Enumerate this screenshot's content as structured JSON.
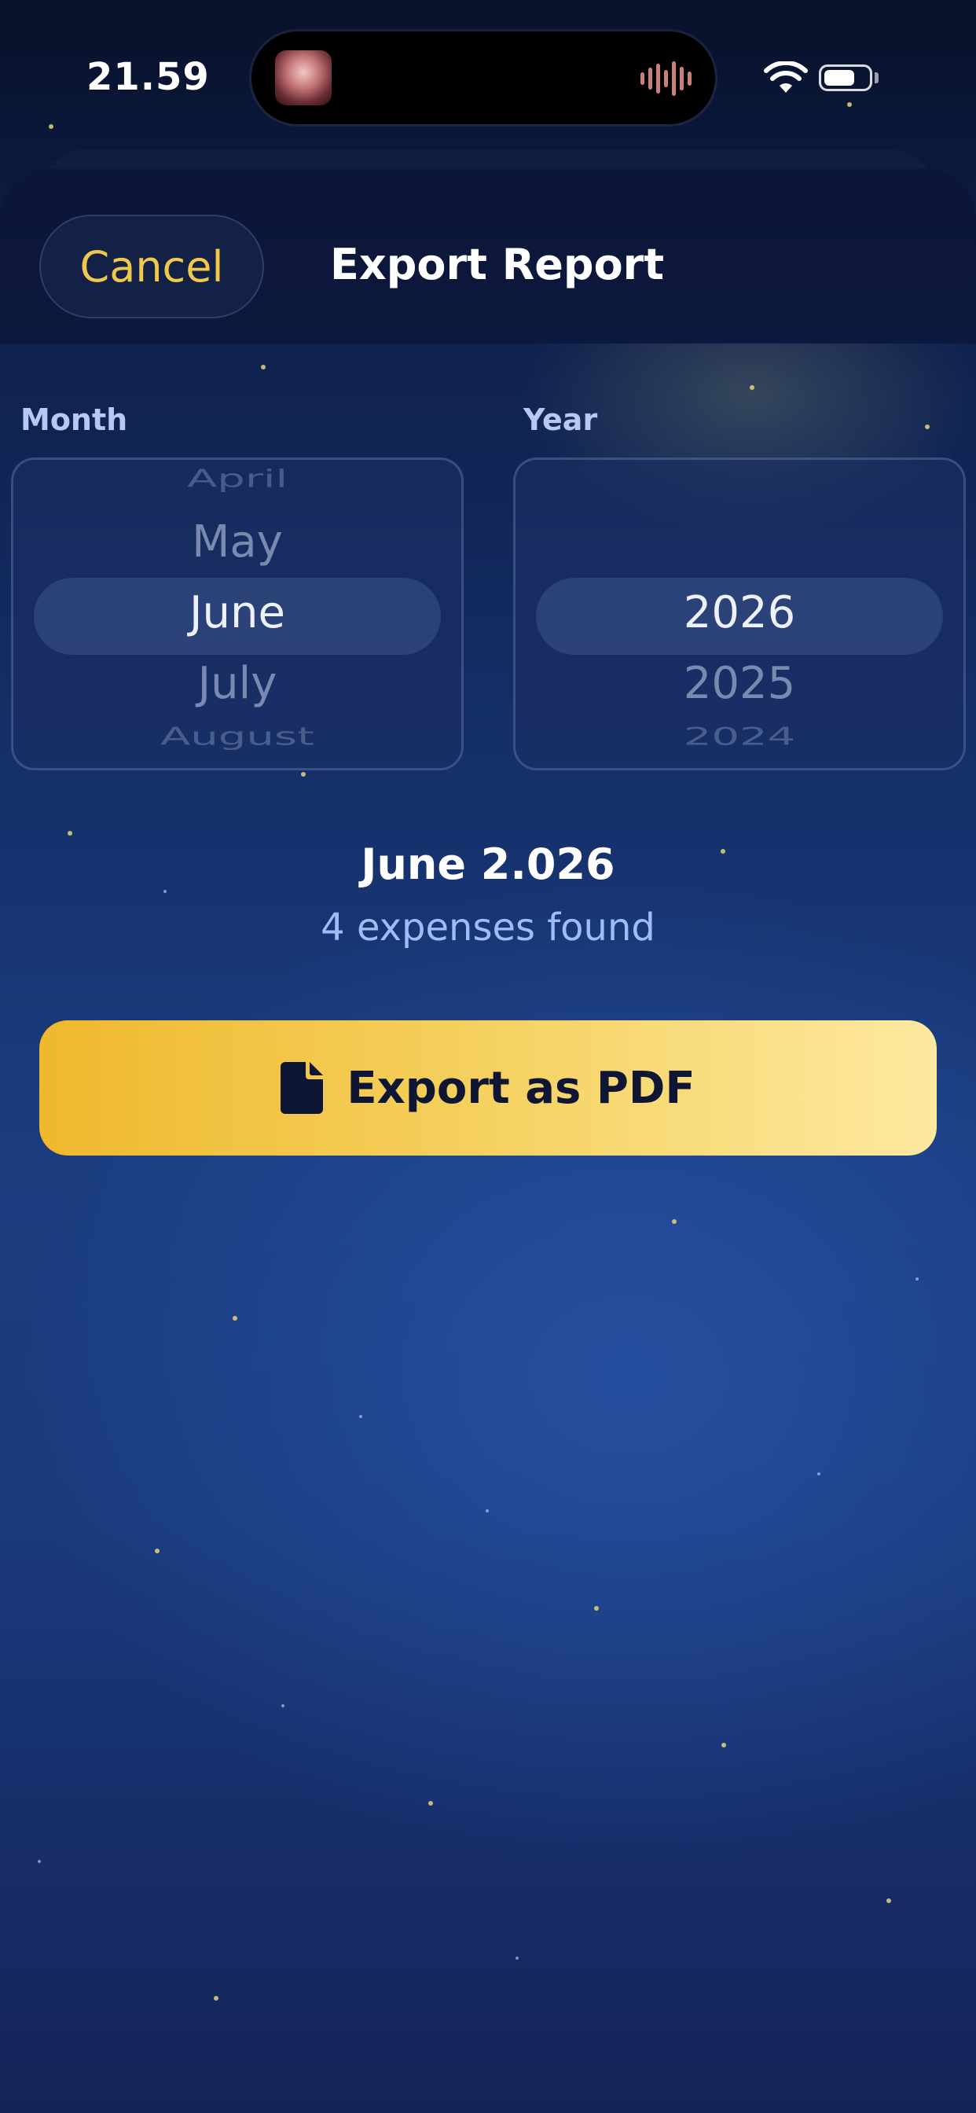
{
  "status_bar": {
    "time": "21.59",
    "battery_level": 0.7,
    "icons": [
      "wifi-icon",
      "battery-icon"
    ]
  },
  "dynamic_island": {
    "icons": [
      "media-thumbnail-icon",
      "audio-waveform-icon"
    ],
    "waveform_color": "#c9807b"
  },
  "header": {
    "cancel_label": "Cancel",
    "title": "Export Report"
  },
  "month_picker": {
    "label": "Month",
    "items": [
      "April",
      "May",
      "June",
      "July",
      "August"
    ],
    "selected": "June"
  },
  "year_picker": {
    "label": "Year",
    "items": [
      "2026",
      "2025",
      "2024"
    ],
    "selected": "2026"
  },
  "summary": {
    "period": "June 2.026",
    "count_text": "4 expenses found"
  },
  "export_button": {
    "label": "Export as PDF",
    "icon": "document-icon"
  },
  "colors": {
    "accent": "#f0c94a",
    "button_gradient_start": "#efb82d",
    "button_gradient_end": "#fde9a0",
    "background": "#1b3d80",
    "secondary_text": "#9fbcf5"
  }
}
